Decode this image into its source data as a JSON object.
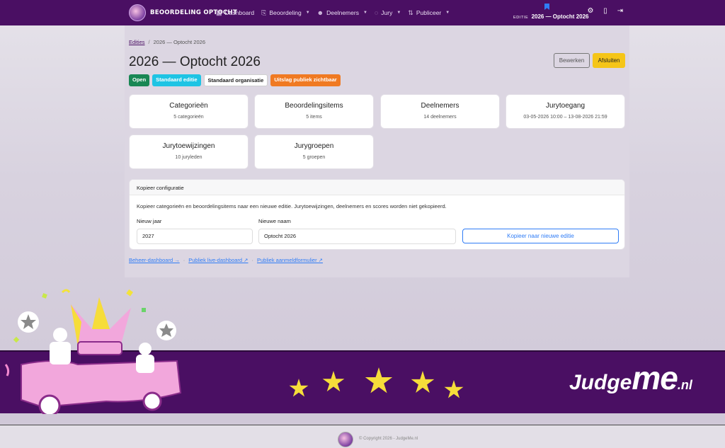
{
  "navbar": {
    "brand": "BEOORDELING OPTOCHT",
    "menu": [
      {
        "label": "Dashboard",
        "icon": "grid-icon"
      },
      {
        "label": "Beoordeling",
        "icon": "clipboard-icon"
      },
      {
        "label": "Deelnemers",
        "icon": "users-icon"
      },
      {
        "label": "Jury",
        "icon": "lightbulb-icon"
      },
      {
        "label": "Publiceer",
        "icon": "arrows-icon"
      }
    ],
    "edition_label": "EDITIE",
    "edition_value": "2026 — Optocht 2026"
  },
  "breadcrumb": {
    "root": "Edities",
    "separator": "/",
    "current": "2026 — Optocht 2026"
  },
  "page": {
    "title": "2026 — Optocht 2026",
    "badges": [
      "Open",
      "Standaard editie",
      "Standaard organisatie",
      "Uitslag publiek zichtbaar"
    ],
    "edit_label": "Bewerken",
    "close_label": "Afsluiten"
  },
  "cards": [
    {
      "title": "Categorieën",
      "sub": "5 categorieën"
    },
    {
      "title": "Beoordelingsitems",
      "sub": "5 items"
    },
    {
      "title": "Deelnemers",
      "sub": "14 deelnemers"
    },
    {
      "title": "Jurytoegang",
      "sub": "03-05-2026 10:00 – 13-08-2026 21:59"
    },
    {
      "title": "Jurytoewijzingen",
      "sub": "10 juryleden"
    },
    {
      "title": "Jurygroepen",
      "sub": "5 groepen"
    }
  ],
  "copy_panel": {
    "header": "Kopieer configuratie",
    "description": "Kopieer categorieën en beoordelingsitems naar een nieuwe editie. Jurytoewijzingen, deelnemers en scores worden niet gekopieerd.",
    "year_label": "Nieuw jaar",
    "year_value": "2027",
    "name_label": "Nieuwe naam",
    "name_value": "Optocht 2026",
    "button": "Kopieer naar nieuwe editie"
  },
  "links": [
    "Beheer-dashboard →",
    "Publiek live-dashboard ↗",
    "Publiek aanmeldformulier ↗"
  ],
  "link_separator": "·",
  "banner": {
    "brand_judge": "Judge",
    "brand_me": "me",
    "brand_tld": ".nl"
  },
  "footer": {
    "copyright": "© Copyright 2026 - JudgeMe.nl"
  },
  "colors": {
    "primary": "#4a0f63",
    "accent": "#f5c518",
    "star": "#f6dd3a",
    "link": "#2f7cf6"
  }
}
